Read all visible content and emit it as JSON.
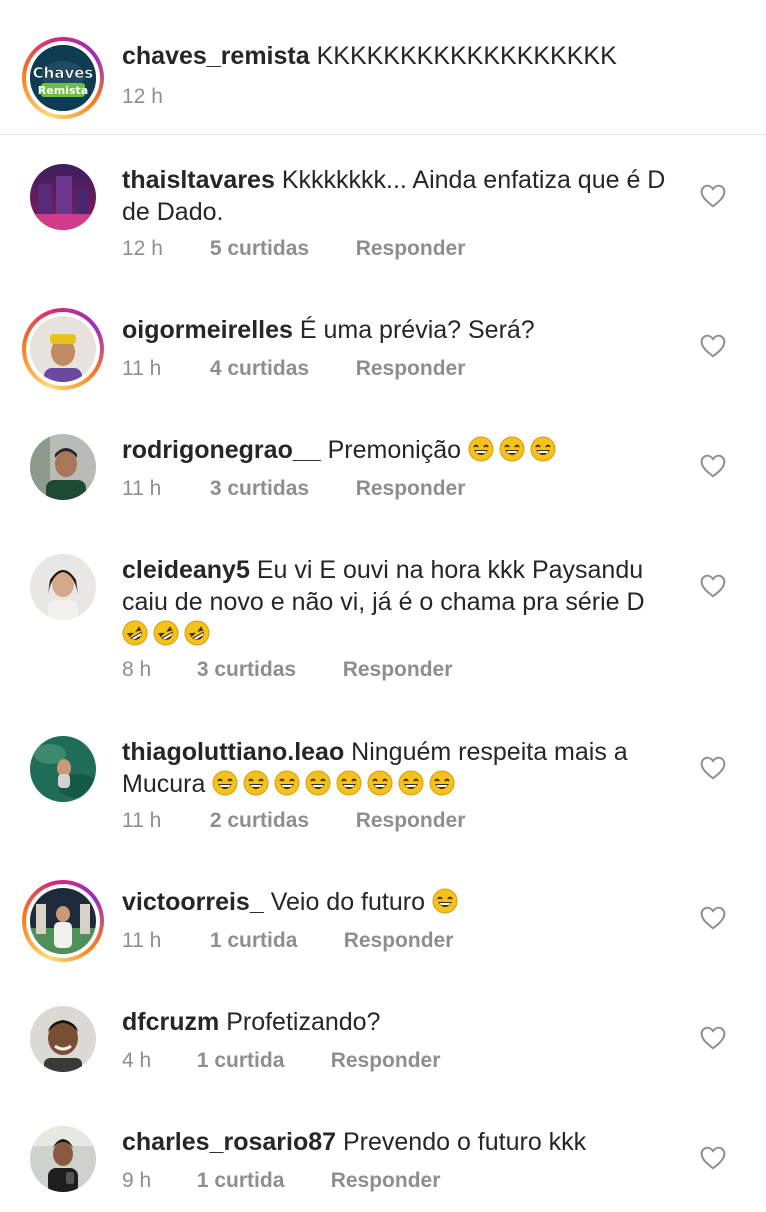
{
  "caption": {
    "username": "chaves_remista",
    "text": "KKKKKKKKKKKKKKKKKK",
    "time": "12 h",
    "avatar_logo_line1": "Chaves",
    "avatar_logo_line2": "Remista"
  },
  "comments": [
    {
      "username": "thaisltavares",
      "text": "Kkkkkkkk... Ainda enfatiza que é D de Dado.",
      "time": "12 h",
      "likes": "5 curtidas",
      "reply": "Responder"
    },
    {
      "username": "oigormeirelles",
      "text": "É uma prévia? Será?",
      "time": "11 h",
      "likes": "4 curtidas",
      "reply": "Responder"
    },
    {
      "username": "rodrigonegrao__",
      "text": "Premonição",
      "emoji": "grinning-sweat-face",
      "emoji_count": 3,
      "time": "11 h",
      "likes": "3 curtidas",
      "reply": "Responder"
    },
    {
      "username": "cleideany5",
      "text": "Eu vi E ouvi na hora kkk  Paysandu caiu de novo e não vi, já é o chama pra série D",
      "emoji": "rolling-laughing-face",
      "emoji_count": 3,
      "time": "8 h",
      "likes": "3 curtidas",
      "reply": "Responder"
    },
    {
      "username": "thiagoluttiano.leao",
      "text": "Ninguém respeita mais a Mucura",
      "emoji": "grinning-sweat-face",
      "emoji_count": 8,
      "time": "11 h",
      "likes": "2 curtidas",
      "reply": "Responder"
    },
    {
      "username": "victoorreis_",
      "text": "Veio do futuro",
      "emoji": "grinning-sweat-face",
      "emoji_count": 1,
      "time": "11 h",
      "likes": "1 curtida",
      "reply": "Responder"
    },
    {
      "username": "dfcruzm",
      "text": "Profetizando?",
      "time": "4 h",
      "likes": "1 curtida",
      "reply": "Responder"
    },
    {
      "username": "charles_rosario87",
      "text": "Prevendo o futuro kkk",
      "time": "9 h",
      "likes": "1 curtida",
      "reply": "Responder"
    }
  ],
  "colors": {
    "text": "#262626",
    "meta": "#8e8e8e",
    "divider": "#e6e6e6",
    "story_ring": [
      "#feda75",
      "#fa7e1e",
      "#d62976",
      "#962fbf"
    ]
  }
}
